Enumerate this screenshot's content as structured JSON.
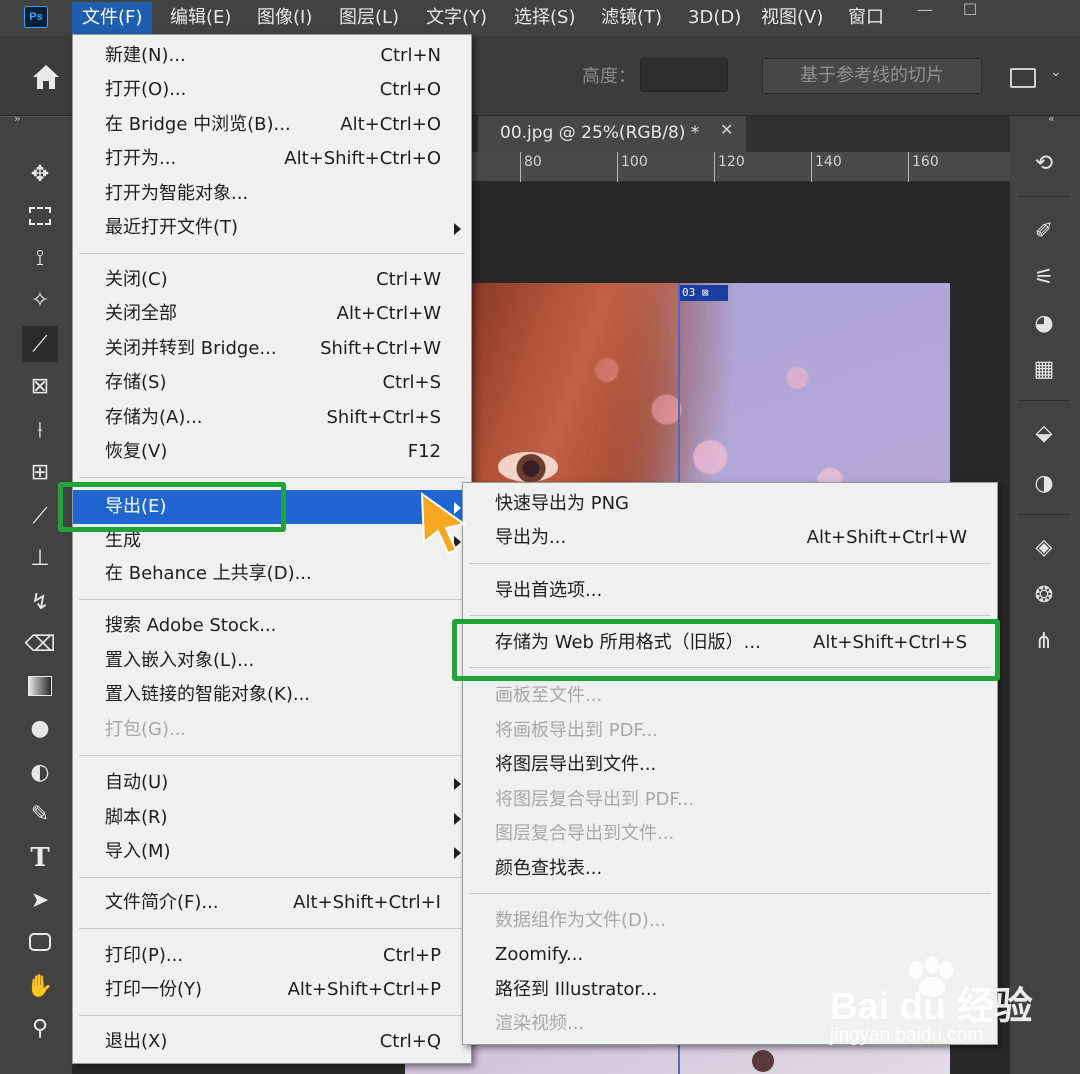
{
  "app": {
    "logo": "Ps"
  },
  "menubar": [
    {
      "label": "文件(F)",
      "active": true
    },
    {
      "label": "编辑(E)"
    },
    {
      "label": "图像(I)"
    },
    {
      "label": "图层(L)"
    },
    {
      "label": "文字(Y)"
    },
    {
      "label": "选择(S)"
    },
    {
      "label": "滤镜(T)"
    },
    {
      "label": "3D(D)"
    },
    {
      "label": "视图(V)"
    },
    {
      "label": "窗口"
    }
  ],
  "window_controls": {
    "minimize": "—",
    "maximize": "☐"
  },
  "options_bar": {
    "height_label": "高度：",
    "height_value": "",
    "slice_button": "基于参考线的切片"
  },
  "document": {
    "tab_title": "00.jpg @ 25%(RGB/8) *",
    "ruler_ticks": [
      "80",
      "100",
      "120",
      "140",
      "160"
    ],
    "slice_badge": "03 ⊠"
  },
  "file_menu": {
    "items": [
      {
        "label": "新建(N)...",
        "shortcut": "Ctrl+N"
      },
      {
        "label": "打开(O)...",
        "shortcut": "Ctrl+O"
      },
      {
        "label": "在 Bridge 中浏览(B)...",
        "shortcut": "Alt+Ctrl+O"
      },
      {
        "label": "打开为...",
        "shortcut": "Alt+Shift+Ctrl+O"
      },
      {
        "label": "打开为智能对象...",
        "shortcut": ""
      },
      {
        "label": "最近打开文件(T)",
        "shortcut": "",
        "submenu": true
      },
      {
        "label": "关闭(C)",
        "shortcut": "Ctrl+W"
      },
      {
        "label": "关闭全部",
        "shortcut": "Alt+Ctrl+W"
      },
      {
        "label": "关闭并转到 Bridge...",
        "shortcut": "Shift+Ctrl+W"
      },
      {
        "label": "存储(S)",
        "shortcut": "Ctrl+S"
      },
      {
        "label": "存储为(A)...",
        "shortcut": "Shift+Ctrl+S"
      },
      {
        "label": "恢复(V)",
        "shortcut": "F12"
      },
      {
        "label": "导出(E)",
        "shortcut": "",
        "submenu": true,
        "highlighted": true
      },
      {
        "label": "生成",
        "shortcut": "",
        "submenu": true
      },
      {
        "label": "在 Behance 上共享(D)...",
        "shortcut": ""
      },
      {
        "label": "搜索 Adobe Stock...",
        "shortcut": ""
      },
      {
        "label": "置入嵌入对象(L)...",
        "shortcut": ""
      },
      {
        "label": "置入链接的智能对象(K)...",
        "shortcut": ""
      },
      {
        "label": "打包(G)...",
        "shortcut": "",
        "disabled": true
      },
      {
        "label": "自动(U)",
        "shortcut": "",
        "submenu": true
      },
      {
        "label": "脚本(R)",
        "shortcut": "",
        "submenu": true
      },
      {
        "label": "导入(M)",
        "shortcut": "",
        "submenu": true
      },
      {
        "label": "文件简介(F)...",
        "shortcut": "Alt+Shift+Ctrl+I"
      },
      {
        "label": "打印(P)...",
        "shortcut": "Ctrl+P"
      },
      {
        "label": "打印一份(Y)",
        "shortcut": "Alt+Shift+Ctrl+P"
      },
      {
        "label": "退出(X)",
        "shortcut": "Ctrl+Q"
      }
    ]
  },
  "export_menu": {
    "items": [
      {
        "label": "快速导出为 PNG",
        "shortcut": ""
      },
      {
        "label": "导出为...",
        "shortcut": "Alt+Shift+Ctrl+W"
      },
      {
        "label": "导出首选项...",
        "shortcut": ""
      },
      {
        "label": "存储为 Web 所用格式（旧版）...",
        "shortcut": "Alt+Shift+Ctrl+S"
      },
      {
        "label": "画板至文件...",
        "shortcut": "",
        "disabled": true
      },
      {
        "label": "将画板导出到 PDF...",
        "shortcut": "",
        "disabled": true
      },
      {
        "label": "将图层导出到文件...",
        "shortcut": ""
      },
      {
        "label": "将图层复合导出到 PDF...",
        "shortcut": "",
        "disabled": true
      },
      {
        "label": "图层复合导出到文件...",
        "shortcut": "",
        "disabled": true
      },
      {
        "label": "颜色查找表...",
        "shortcut": ""
      },
      {
        "label": "数据组作为文件(D)...",
        "shortcut": "",
        "disabled": true
      },
      {
        "label": "Zoomify...",
        "shortcut": ""
      },
      {
        "label": "路径到 Illustrator...",
        "shortcut": ""
      },
      {
        "label": "渲染视频...",
        "shortcut": "",
        "disabled": true
      }
    ]
  },
  "tools_left": [
    "move-icon",
    "marquee-icon",
    "lasso-icon",
    "magic-wand-icon",
    "slice-icon",
    "frame-icon",
    "eyedropper-icon",
    "patch-icon",
    "brush-icon",
    "stamp-icon",
    "history-brush-icon",
    "eraser-icon",
    "gradient-icon",
    "blur-icon",
    "dodge-icon",
    "pen-icon",
    "type-icon",
    "path-select-icon",
    "shape-icon",
    "hand-icon",
    "zoom-icon"
  ],
  "watermark": {
    "brand": "Bai du 经验",
    "url": "jingyan.baidu.com"
  },
  "colors": {
    "highlight": "#1f66d1",
    "annotation_box": "#21a335",
    "menu_bg": "#f0f0f0"
  }
}
